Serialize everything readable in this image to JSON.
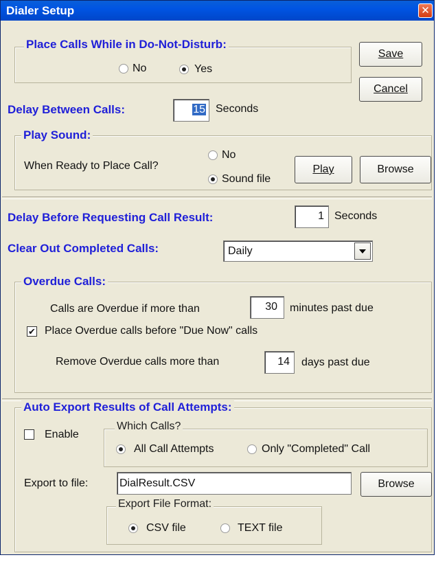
{
  "window": {
    "title": "Dialer Setup",
    "close_glyph": "✕"
  },
  "dnd": {
    "legend": "Place Calls While in Do-Not-Disturb:",
    "no_label": "No",
    "yes_label": "Yes",
    "selected": "Yes"
  },
  "buttons": {
    "save_label": "Save",
    "cancel_label": "Cancel"
  },
  "delay_calls": {
    "label": "Delay Between Calls:",
    "value": "15",
    "unit": "Seconds"
  },
  "play_sound": {
    "legend": "Play Sound:",
    "prompt": "When Ready to Place Call?",
    "no_label": "No",
    "sound_file_label": "Sound file",
    "selected": "Sound file",
    "play_label": "Play",
    "browse_label": "Browse"
  },
  "delay_result": {
    "label": "Delay Before Requesting Call Result:",
    "value": "1",
    "unit": "Seconds"
  },
  "clear_out": {
    "label": "Clear Out Completed Calls:",
    "selected": "Daily"
  },
  "overdue": {
    "legend": "Overdue Calls:",
    "overdue_prefix": "Calls are Overdue if more than",
    "overdue_value": "30",
    "overdue_suffix": "minutes past due",
    "place_before_label": "Place Overdue calls before \"Due Now\" calls",
    "place_before_checked": true,
    "remove_prefix": "Remove Overdue calls more than",
    "remove_value": "14",
    "remove_suffix": "days past due"
  },
  "auto_export": {
    "legend": "Auto Export Results of Call Attempts:",
    "enable_label": "Enable",
    "enable_checked": false,
    "which_legend": "Which Calls?",
    "all_label": "All Call Attempts",
    "completed_label": "Only \"Completed\" Call",
    "which_selected": "All Call Attempts",
    "export_label": "Export to file:",
    "export_value": "DialResult.CSV",
    "browse_label": "Browse",
    "format_legend": "Export File Format:",
    "csv_label": "CSV file",
    "text_label": "TEXT file",
    "format_selected": "CSV file"
  }
}
